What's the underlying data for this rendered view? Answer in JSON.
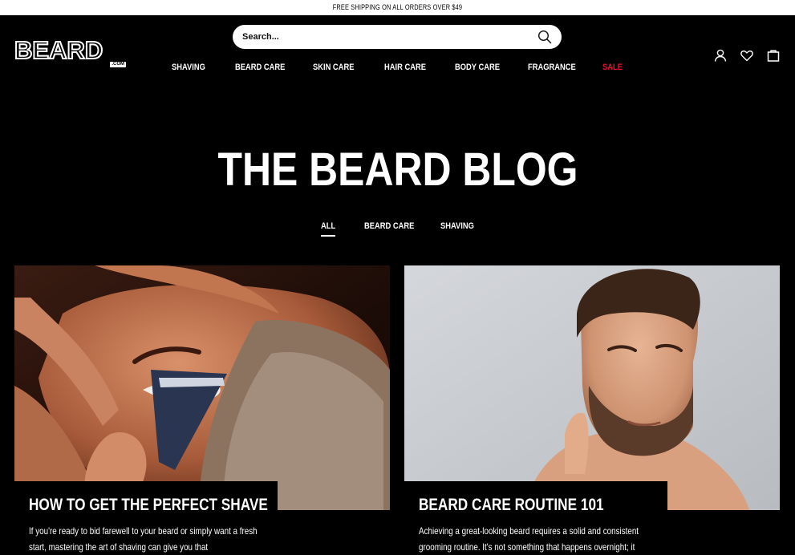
{
  "promo": {
    "text": "FREE SHIPPING ON ALL ORDERS OVER $49"
  },
  "logo": {
    "main": "BEARD",
    "com": ".COM"
  },
  "search": {
    "placeholder": "Search..."
  },
  "nav": {
    "items": [
      {
        "label": "SHAVING"
      },
      {
        "label": "BEARD CARE"
      },
      {
        "label": "SKIN CARE"
      },
      {
        "label": "HAIR CARE"
      },
      {
        "label": "BODY CARE"
      },
      {
        "label": "FRAGRANCE"
      },
      {
        "label": "SALE"
      }
    ],
    "sale_color": "#e8112d"
  },
  "header_icons": [
    "account-icon",
    "wishlist-heart-icon",
    "cart-bag-icon"
  ],
  "page": {
    "title": "THE BEARD BLOG"
  },
  "filters": {
    "items": [
      {
        "label": "ALL",
        "active": true
      },
      {
        "label": "BEARD CARE",
        "active": false
      },
      {
        "label": "SHAVING",
        "active": false
      }
    ]
  },
  "posts": [
    {
      "title": "HOW TO GET THE PERFECT SHAVE",
      "excerpt": "If you're ready to bid farewell to your beard or simply want a fresh start, mastering the art of shaving can give you that"
    },
    {
      "title": "BEARD CARE ROUTINE 101",
      "excerpt": "Achieving a great-looking beard requires a solid and consistent grooming routine. It's not something that happens overnight; it"
    }
  ]
}
